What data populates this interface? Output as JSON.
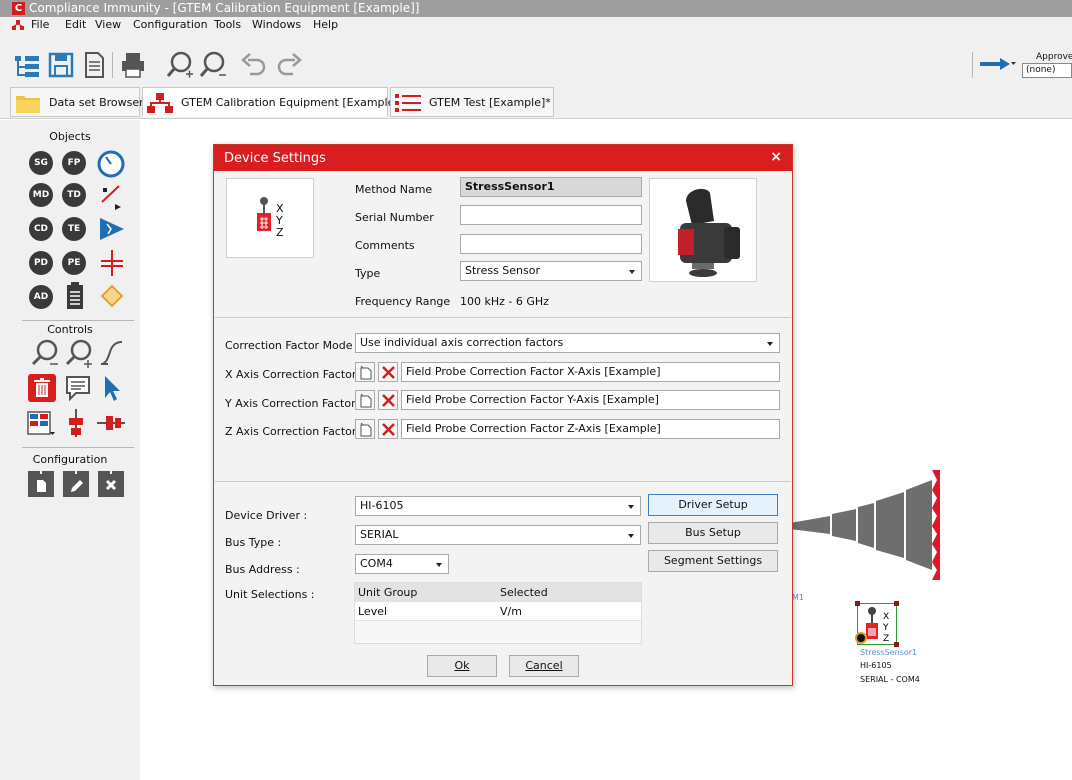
{
  "window": {
    "logo_letter": "C",
    "title": "Compliance Immunity - [GTEM Calibration Equipment [Example]]"
  },
  "menu": [
    "File",
    "Edit",
    "View",
    "Configuration",
    "Tools",
    "Windows",
    "Help"
  ],
  "toolbar": {
    "approved_label": "Approved T",
    "approved_value": "(none)"
  },
  "tabs": [
    {
      "label": "Data set Browser",
      "icon": "folder-icon"
    },
    {
      "label": "GTEM Calibration Equipment [Example]",
      "icon": "network-icon"
    },
    {
      "label": "GTEM Test [Example]*",
      "icon": "list-icon"
    }
  ],
  "left_panel": {
    "objects_header": "Objects",
    "controls_header": "Controls",
    "configuration_header": "Configuration",
    "object_buttons": [
      "SG",
      "FP",
      "MD",
      "TD",
      "CD",
      "TE",
      "PD",
      "PE",
      "AD"
    ]
  },
  "dialog": {
    "title": "Device Settings",
    "method_name_label": "Method Name",
    "method_name": "StressSensor1",
    "serial_number_label": "Serial Number",
    "serial_number": "",
    "comments_label": "Comments",
    "comments": "",
    "type_label": "Type",
    "type": "Stress Sensor",
    "frequency_range_label": "Frequency Range",
    "frequency_range": "100 kHz - 6 GHz",
    "device_axes": [
      "X",
      "Y",
      "Z"
    ],
    "correction_factor_mode_label": "Correction Factor Mode",
    "correction_factor_mode": "Use individual axis correction factors",
    "x_axis_label": "X Axis Correction Factor",
    "x_axis_value": "Field Probe Correction Factor X-Axis [Example]",
    "y_axis_label": "Y Axis Correction Factor",
    "y_axis_value": "Field Probe Correction Factor Y-Axis [Example]",
    "z_axis_label": "Z Axis Correction Factor",
    "z_axis_value": "Field Probe Correction Factor Z-Axis [Example]",
    "device_driver_label": "Device Driver :",
    "device_driver": "HI-6105",
    "driver_setup_button": "Driver Setup",
    "bus_type_label": "Bus Type :",
    "bus_type": "SERIAL",
    "bus_setup_button": "Bus Setup",
    "bus_address_label": "Bus Address :",
    "bus_address": "COM4",
    "segment_settings_button": "Segment Settings",
    "unit_selections_label": "Unit Selections :",
    "unit_table": {
      "columns": [
        "Unit Group",
        "Selected"
      ],
      "rows": [
        [
          "Level",
          "V/m"
        ]
      ]
    },
    "ok_button": "Ok",
    "cancel_button": "Cancel"
  },
  "canvas": {
    "partial_label": "M1",
    "device_name": "StressSensor1",
    "device_driver": "HI-6105",
    "device_bus": "SERIAL - COM4"
  }
}
